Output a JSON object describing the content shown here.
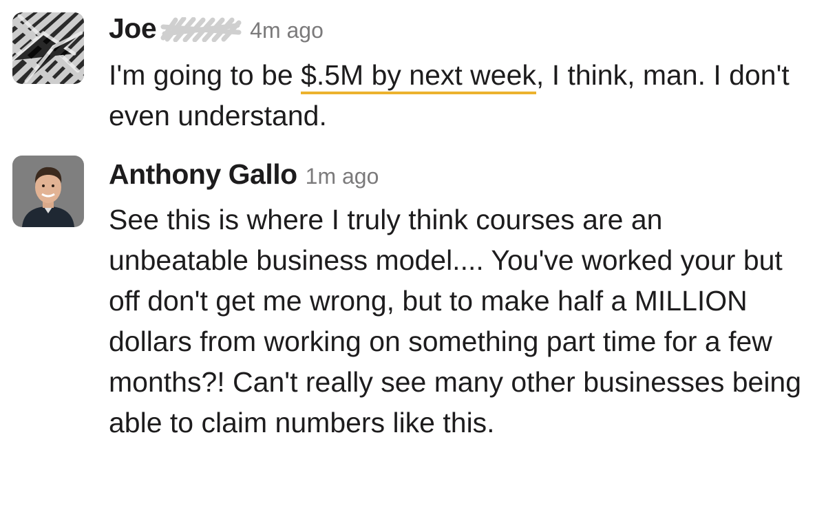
{
  "messages": [
    {
      "sender": "Joe",
      "timestamp": "4m ago",
      "text_before": "I'm going to be ",
      "text_highlight": "$.5M by next week",
      "text_after": ", I think, man. I don't even understand.",
      "avatar": "redacted-avatar",
      "name_redacted": true
    },
    {
      "sender": "Anthony Gallo",
      "timestamp": "1m ago",
      "text": "See this is where I truly think courses are an unbeatable business model.... You've worked your but off don't get me wrong, but to make half a MILLION dollars from working on something part time for a few months?! Can't really see many other businesses being able to claim numbers like this.",
      "avatar": "person-photo-avatar"
    }
  ],
  "colors": {
    "highlight_underline": "#ecb22e",
    "timestamp": "#7b7a7b",
    "text": "#1d1c1d"
  }
}
